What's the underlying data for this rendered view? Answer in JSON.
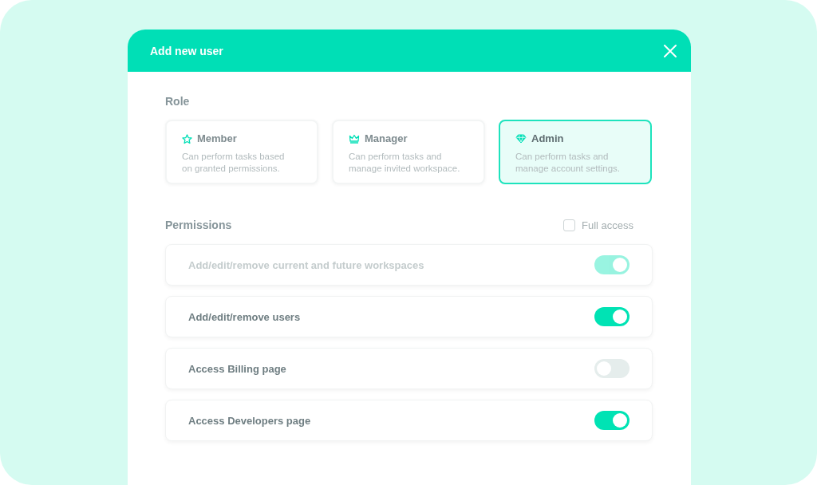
{
  "dialog": {
    "title": "Add new user"
  },
  "role": {
    "heading": "Role",
    "options": [
      {
        "name": "Member",
        "description": "Can perform tasks based on granted permissions.",
        "selected": false
      },
      {
        "name": "Manager",
        "description": "Can perform tasks and manage invited workspace.",
        "selected": false
      },
      {
        "name": "Admin",
        "description": "Can perform tasks and manage account settings.",
        "selected": true
      }
    ]
  },
  "permissions": {
    "heading": "Permissions",
    "full_access": {
      "label": "Full access",
      "checked": false
    },
    "items": [
      {
        "label": "Add/edit/remove current and future workspaces",
        "on": true,
        "disabled": true
      },
      {
        "label": "Add/edit/remove users",
        "on": true,
        "disabled": false
      },
      {
        "label": "Access Billing page",
        "on": false,
        "disabled": false
      },
      {
        "label": "Access Developers page",
        "on": true,
        "disabled": false
      }
    ]
  }
}
